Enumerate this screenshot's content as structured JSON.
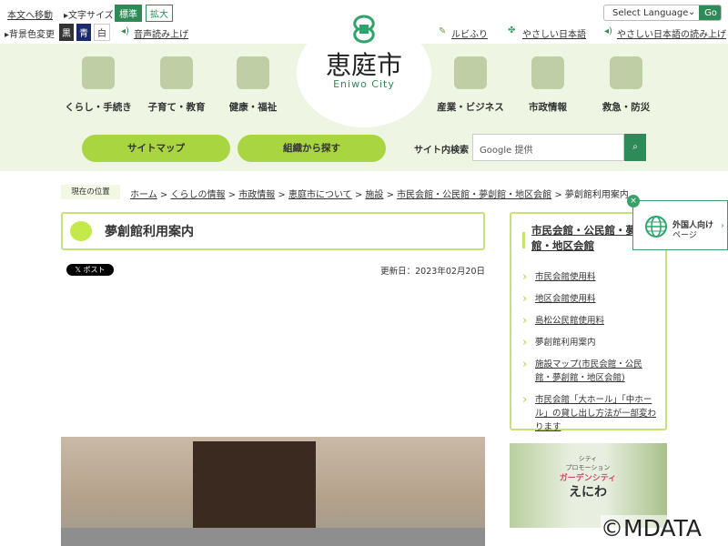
{
  "topbar": {
    "skip": "本文へ移動",
    "font_size_label": "文字サイズ",
    "font_standard": "標準",
    "font_large": "拡大",
    "bg_label": "背景色変更",
    "bg_black": "黒",
    "bg_blue": "青",
    "bg_white": "白",
    "speech": "音声読み上げ",
    "language_select": "Select Language",
    "go": "Go",
    "ruby": "ルビふり",
    "easy_japanese": "やさしい日本語",
    "easy_japanese_speech": "やさしい日本語の読み上げ"
  },
  "logo": {
    "name": "恵庭市",
    "sub": "Eniwo City"
  },
  "nav": [
    {
      "label": "くらし・手続き",
      "icon": "document-pen-icon"
    },
    {
      "label": "子育て・教育",
      "icon": "stroller-icon"
    },
    {
      "label": "健康・福祉",
      "icon": "exercise-icon"
    },
    {
      "label": "産業・ビジネス",
      "icon": "handshake-icon"
    },
    {
      "label": "市政情報",
      "icon": "city-hall-icon"
    },
    {
      "label": "救急・防災",
      "icon": "ambulance-icon"
    }
  ],
  "buttons": {
    "sitemap": "サイトマップ",
    "org": "組織から探す"
  },
  "search": {
    "label": "サイト内検索",
    "placeholder": "Google 提供"
  },
  "breadcrumb": {
    "label": "現在の位置",
    "items": [
      "ホーム",
      "くらしの情報",
      "市政情報",
      "恵庭市について",
      "施設",
      "市民会館・公民館・夢創館・地区会館"
    ],
    "current": "夢創館利用案内"
  },
  "page": {
    "title": "夢創館利用案内",
    "post": "ポスト",
    "updated": "更新日：2023年02月20日"
  },
  "sidebar": {
    "title": "市民会館・公民館・夢創館・地区会館",
    "items": [
      "市民会館使用料",
      "地区会館使用料",
      "島松公民館使用料",
      "夢創館利用案内",
      "施設マップ(市民会館・公民館・夢創館・地区会館)",
      "市民会館「大ホール」「中ホール」の貸し出し方法が一部変わります"
    ]
  },
  "foreign": {
    "label1": "外国人向け",
    "label2": "ページ"
  },
  "banner": {
    "line1": "シティ",
    "line2": "プロモーション",
    "line3": "ガーデンシティ",
    "line4": "えにわ"
  },
  "watermark": "©MDATA",
  "colors": {
    "green": "#2e8b57",
    "lime": "#a8d540",
    "bg": "#eef5e2"
  }
}
